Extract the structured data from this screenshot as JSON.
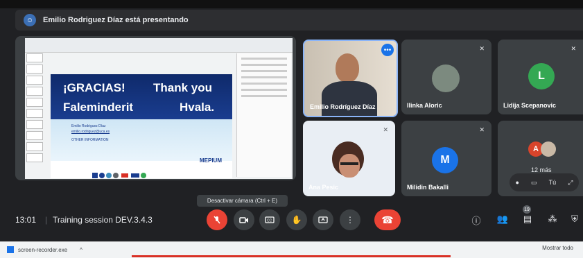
{
  "banner": {
    "text": "Emilio Rodriguez Díaz está presentando"
  },
  "slide": {
    "line1a": "¡GRACIAS!",
    "line1b": "Thank you",
    "line2a": "Faleminderit",
    "line2b": "Hvala.",
    "contact_name": "Emilio Rodriguez Díaz",
    "contact_email": "emilio.rodriguez@uca.es",
    "other_info": "OTHER INFORMATION",
    "logo_text": "MEPIUM"
  },
  "tiles": {
    "presenter_name": "Emilio Rodríguez Díaz",
    "t1_name": "Ilinka Aloric",
    "t2_name": "Lidija Scepanovic",
    "t2_initial": "L",
    "t3_name": "Ana Pesic",
    "t4_name": "Milidin Bakalli",
    "t4_initial": "M",
    "t5_initial": "A",
    "t5_more": "12 más",
    "self_label": "Tú"
  },
  "colors": {
    "green_avatar": "#34a853",
    "blue_avatar": "#1a73e8",
    "red_avatar": "#d9442b",
    "red_button": "#ea4335"
  },
  "bottom_bar": {
    "time": "13:01",
    "separator": "|",
    "meeting_name": "Training session DEV.3.4.3",
    "tooltip": "Desactivar cámara (Ctrl + E)",
    "participants_count": "19"
  },
  "taskbar": {
    "file_name": "screen-recorder.exe",
    "chevron": "^",
    "show_all": "Mostrar todo"
  }
}
